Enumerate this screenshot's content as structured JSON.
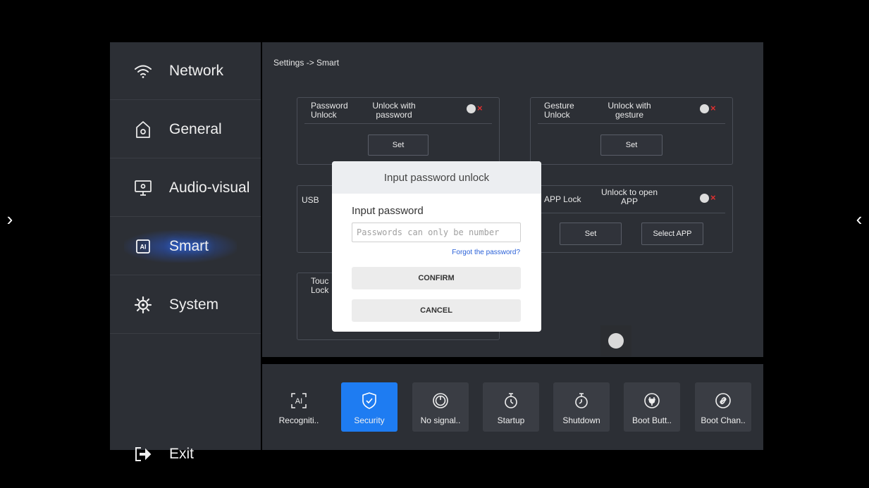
{
  "nav": {
    "left_arrow": "›",
    "right_arrow": "‹"
  },
  "sidebar": {
    "items": [
      {
        "label": "Network",
        "icon": "wifi-icon"
      },
      {
        "label": "General",
        "icon": "general-settings-icon"
      },
      {
        "label": "Audio-visual",
        "icon": "monitor-icon"
      },
      {
        "label": "Smart",
        "icon": "ai-chip-icon",
        "active": true
      },
      {
        "label": "System",
        "icon": "system-gear-icon"
      }
    ],
    "exit": {
      "label": "Exit",
      "icon": "exit-icon"
    }
  },
  "main": {
    "breadcrumb": "Settings -> Smart",
    "password_card": {
      "title": "Password\nUnlock",
      "desc": "Unlock with\npassword",
      "toggle": "off",
      "set_label": "Set"
    },
    "gesture_card": {
      "title": "Gesture\nUnlock",
      "desc": "Unlock with\ngesture",
      "toggle": "off",
      "set_label": "Set"
    },
    "usb_card": {
      "title": "USB"
    },
    "app_lock_card": {
      "title": "APP Lock",
      "desc": "Unlock to open\nAPP",
      "toggle": "off",
      "set_label": "Set",
      "select_label": "Select APP"
    },
    "touch_card": {
      "title": "Touc\nLock"
    }
  },
  "bottom_bar": {
    "tiles": [
      {
        "label": "Recogniti..",
        "icon": "ai-recognition-icon"
      },
      {
        "label": "Security",
        "icon": "shield-check-icon",
        "active": true
      },
      {
        "label": "No signal..",
        "icon": "power-icon"
      },
      {
        "label": "Startup",
        "icon": "timer-icon"
      },
      {
        "label": "Shutdown",
        "icon": "timer-icon"
      },
      {
        "label": "Boot Butt..",
        "icon": "plug-icon"
      },
      {
        "label": "Boot Chan..",
        "icon": "link-icon"
      }
    ]
  },
  "dialog": {
    "title": "Input password unlock",
    "label": "Input password",
    "placeholder": "Passwords can only be number",
    "value": "",
    "forgot": "Forgot the password?",
    "confirm": "CONFIRM",
    "cancel": "CANCEL"
  },
  "colors": {
    "accent": "#1e7cf2",
    "panel": "#2c2f35",
    "toggle_off_x": "#e03030",
    "link": "#2a61d8"
  }
}
